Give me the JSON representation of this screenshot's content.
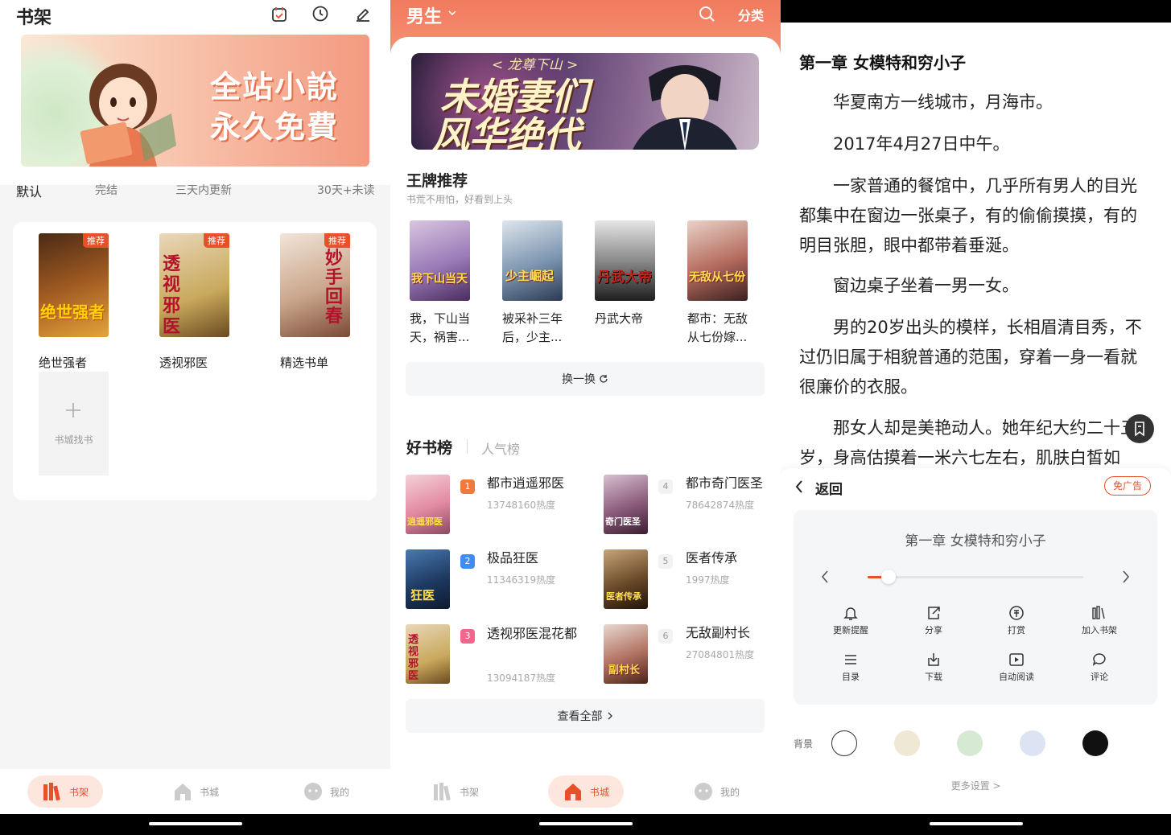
{
  "bookshelf": {
    "title": "书架",
    "banner": {
      "line1": "全站小說",
      "line2": "永久免費"
    },
    "filters": [
      "默认",
      "完结",
      "三天内更新",
      "30天+未读"
    ],
    "badge": "推荐",
    "books": [
      {
        "title": "绝世强者",
        "cover_text": "绝世强者"
      },
      {
        "title": "透视邪医",
        "cover_text": "透视邪医"
      },
      {
        "title": "精选书单",
        "cover_text": "妙手回春"
      }
    ],
    "add_label": "书城找书"
  },
  "tabbar": {
    "shelf": "书架",
    "store": "书城",
    "mine": "我的"
  },
  "store": {
    "channel": "男生",
    "category": "分类",
    "hero": {
      "subtitle": "< 龙尊下山 >",
      "line1": "未婚妻们",
      "line2": "风华绝代"
    },
    "ace": {
      "title": "王牌推荐",
      "subtitle": "书荒不用怕，好看到上头",
      "books": [
        {
          "title": "我，下山当天，祸害...",
          "cover_text": "我下山当天"
        },
        {
          "title": "被采补三年后，少主...",
          "cover_text": "少主崛起"
        },
        {
          "title": "丹武大帝",
          "cover_text": "丹武大帝"
        },
        {
          "title": "都市：无敌从七份嫁...",
          "cover_text": "无敌从七份"
        }
      ],
      "refresh": "换一换"
    },
    "ranking": {
      "tab_active": "好书榜",
      "tab_other": "人气榜",
      "items": [
        {
          "rank": "1",
          "name": "都市逍遥邪医",
          "heat": "13748160热度",
          "cover_text": "逍遥邪医"
        },
        {
          "rank": "2",
          "name": "极品狂医",
          "heat": "11346319热度",
          "cover_text": "狂医"
        },
        {
          "rank": "3",
          "name": "透视邪医混花都",
          "heat": "13094187热度",
          "cover_text": "透视邪医"
        },
        {
          "rank": "4",
          "name": "都市奇门医圣",
          "heat": "78642874热度",
          "cover_text": "奇门医圣"
        },
        {
          "rank": "5",
          "name": "医者传承",
          "heat": "1997热度",
          "cover_text": "医者传承"
        },
        {
          "rank": "6",
          "name": "无敌副村长",
          "heat": "27084801热度",
          "cover_text": "副村长"
        }
      ],
      "view_all": "查看全部"
    }
  },
  "reader": {
    "chapter_title": "第一章 女模特和穷小子",
    "paragraphs": [
      "华夏南方一线城市，月海市。",
      "2017年4月27日中午。",
      "一家普通的餐馆中，几乎所有男人的目光都集中在窗边一张桌子，有的偷偷摸摸，有的明目张胆，眼中都带着垂涎。",
      "窗边桌子坐着一男一女。",
      "男的20岁出头的模样，长相眉清目秀，不过仍旧属于相貌普通的范围，穿着一身一看就很廉价的衣服。",
      "那女人却是美艳动人。她年纪大约二十五岁，身高估摸着一米六七左右，肌肤白皙如"
    ],
    "back": "返回",
    "no_ads": "免广告",
    "panel_chapter": "第一章 女模特和穷小子",
    "progress": 0.08,
    "menu": [
      "更新提醒",
      "分享",
      "打赏",
      "加入书架",
      "目录",
      "下载",
      "自动阅读",
      "评论"
    ],
    "bg_label": "背景",
    "bg_colors": [
      "#ffffff",
      "#efe8d4",
      "#d6e9d2",
      "#dce3f2",
      "#111111"
    ],
    "more_settings": "更多设置 >"
  },
  "colors": {
    "accent": "#e8502a",
    "header": "#f47c5f"
  }
}
